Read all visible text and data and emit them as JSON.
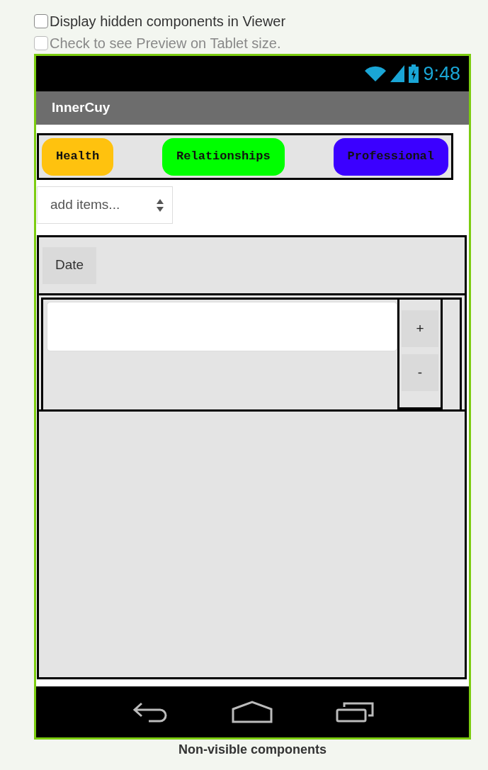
{
  "options": [
    {
      "label": "Display hidden components in Viewer",
      "checked": false,
      "disabled": false
    },
    {
      "label": "Check to see Preview on Tablet size.",
      "checked": false,
      "disabled": true
    }
  ],
  "phone": {
    "status_bar": {
      "time": "9:48"
    },
    "title": "InnerCuy",
    "category_buttons": [
      {
        "label": "Health",
        "color": "#ffc20e"
      },
      {
        "label": "Relationships",
        "color": "#00ff00"
      },
      {
        "label": "Professional",
        "color": "#3b00ff"
      }
    ],
    "picker": {
      "value": "add items..."
    },
    "date_button": "Date",
    "step_buttons": [
      "+",
      "-"
    ]
  },
  "footer_heading": "Non-visible components"
}
